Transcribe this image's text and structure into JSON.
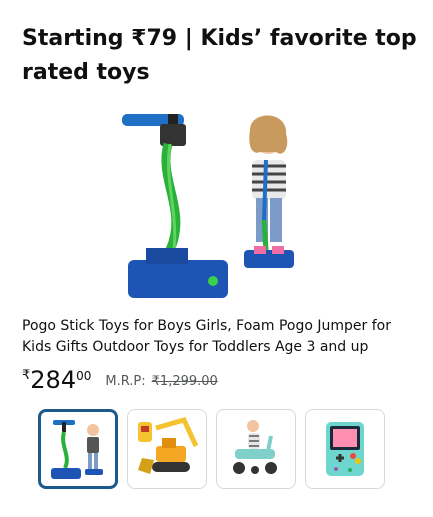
{
  "header": {
    "title": "Starting ₹79 | Kids’ favorite top rated toys"
  },
  "product": {
    "image_icon": "pogo-stick-hero-image",
    "title": "Pogo Stick Toys for Boys Girls, Foam Pogo Jumper for Kids Gifts Outdoor Toys for Toddlers Age 3 and up",
    "price": {
      "currency": "₹",
      "whole": "284",
      "fraction": "00"
    },
    "mrp": {
      "label": "M.R.P:",
      "value": "₹1,299.00"
    }
  },
  "thumbnails": [
    {
      "icon": "pogo-stick-thumbnail",
      "selected": true
    },
    {
      "icon": "excavator-toy-thumbnail",
      "selected": false
    },
    {
      "icon": "ride-on-toy-thumbnail",
      "selected": false
    },
    {
      "icon": "handheld-game-thumbnail",
      "selected": false
    }
  ],
  "colors": {
    "accent": "#1d5a8c",
    "mrp_text": "#565959",
    "text": "#0f1111"
  }
}
